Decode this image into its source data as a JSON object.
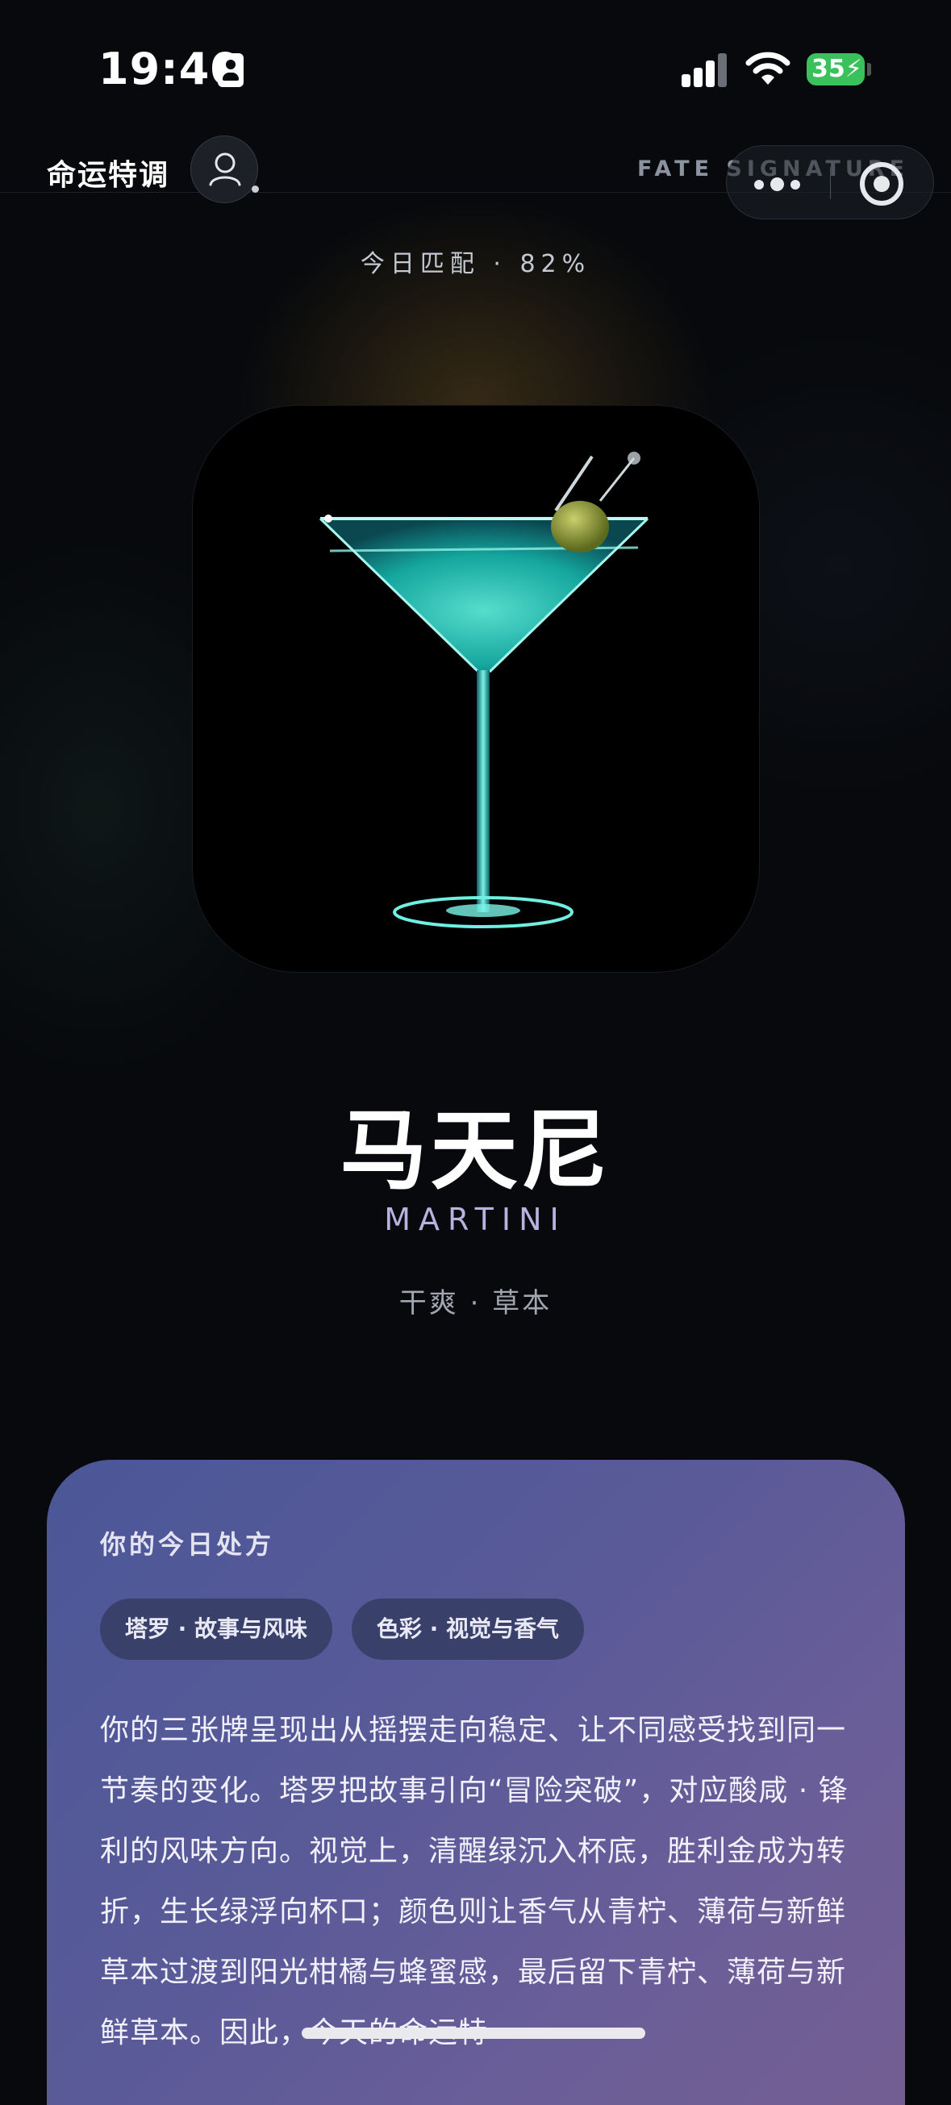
{
  "status_bar": {
    "time": "19:40",
    "battery": "35"
  },
  "header": {
    "app_title": "命运特调",
    "brand": "FATE SIGNATURE"
  },
  "match": "今日匹配 · 82%",
  "drink": {
    "name_cn": "马天尼",
    "name_en": "MARTINI",
    "flavor": "干爽 · 草本"
  },
  "prescription": {
    "title": "你的今日处方",
    "chips": [
      "塔罗 · 故事与风味",
      "色彩 · 视觉与香气"
    ],
    "body": "你的三张牌呈现出从摇摆走向稳定、让不同感受找到同一节奏的变化。塔罗把故事引向“冒险突破”，对应酸咸 · 锋利的风味方向。视觉上，清醒绿沉入杯底，胜利金成为转折，生长绿浮向杯口；颜色则让香气从青柠、薄荷与新鲜草本过渡到阳光柑橘与蜂蜜感，最后留下青柠、薄荷与新鲜草本。因此，今天的命运特"
  },
  "colors": {
    "background": "#07090c",
    "panel_start": "#4b5798",
    "panel_end": "#735e92",
    "chip": "#39406a",
    "accent_teal": "#2fe3d0",
    "battery": "#3ac15b"
  },
  "icons": [
    "id-card-icon",
    "signal-icon",
    "wifi-icon",
    "battery-icon",
    "user-icon",
    "more-icon",
    "close-icon",
    "martini-glass-image"
  ]
}
